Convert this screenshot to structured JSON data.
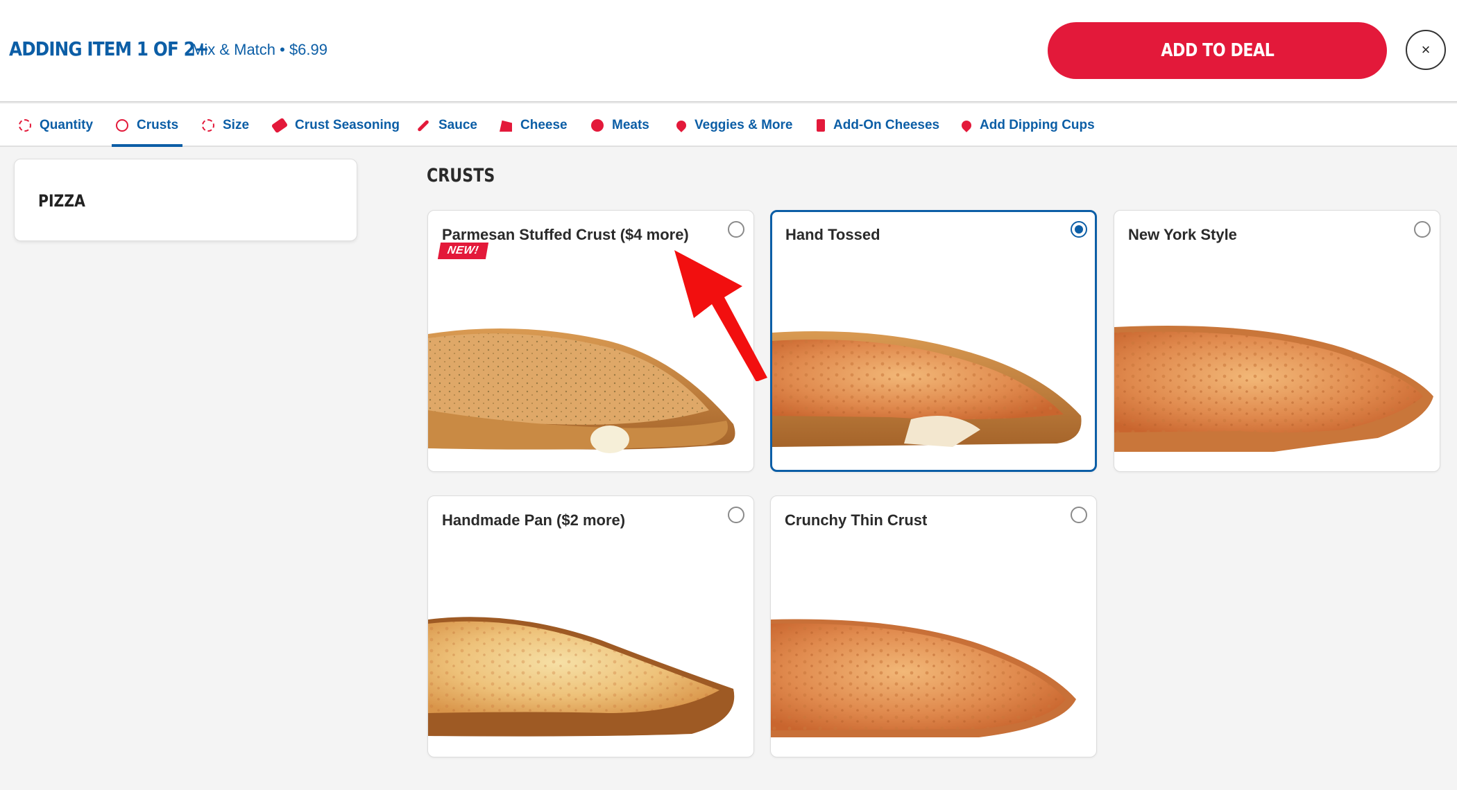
{
  "header": {
    "title": "ADDING ITEM 1 OF 2+",
    "subtitle": "Mix & Match • $6.99",
    "add_button": "ADD TO DEAL",
    "close_glyph": "×"
  },
  "tabs": [
    {
      "label": "Quantity",
      "icon": "dashed-circle-icon"
    },
    {
      "label": "Crusts",
      "icon": "circle-icon",
      "active": true
    },
    {
      "label": "Size",
      "icon": "dashed-circle-icon"
    },
    {
      "label": "Crust Seasoning",
      "icon": "seasoning-tag-icon"
    },
    {
      "label": "Sauce",
      "icon": "sauce-brush-icon"
    },
    {
      "label": "Cheese",
      "icon": "cheese-icon"
    },
    {
      "label": "Meats",
      "icon": "pepperoni-icon"
    },
    {
      "label": "Veggies & More",
      "icon": "pepper-icon"
    },
    {
      "label": "Add-On Cheeses",
      "icon": "cheese-block-icon"
    },
    {
      "label": "Add Dipping Cups",
      "icon": "dipping-cup-icon"
    }
  ],
  "sidebar": {
    "category": "PIZZA"
  },
  "section": {
    "title": "CRUSTS"
  },
  "crusts": [
    {
      "label": "Parmesan Stuffed Crust ($4 more)",
      "badge": "NEW!",
      "selected": false
    },
    {
      "label": "Hand Tossed",
      "selected": true
    },
    {
      "label": "New York Style",
      "selected": false
    },
    {
      "label": "Handmade Pan ($2 more)",
      "selected": false
    },
    {
      "label": "Crunchy Thin Crust",
      "selected": false
    }
  ],
  "colors": {
    "brand_blue": "#0c5ea6",
    "brand_red": "#e3193a",
    "annotation_arrow": "#f20f0f"
  }
}
